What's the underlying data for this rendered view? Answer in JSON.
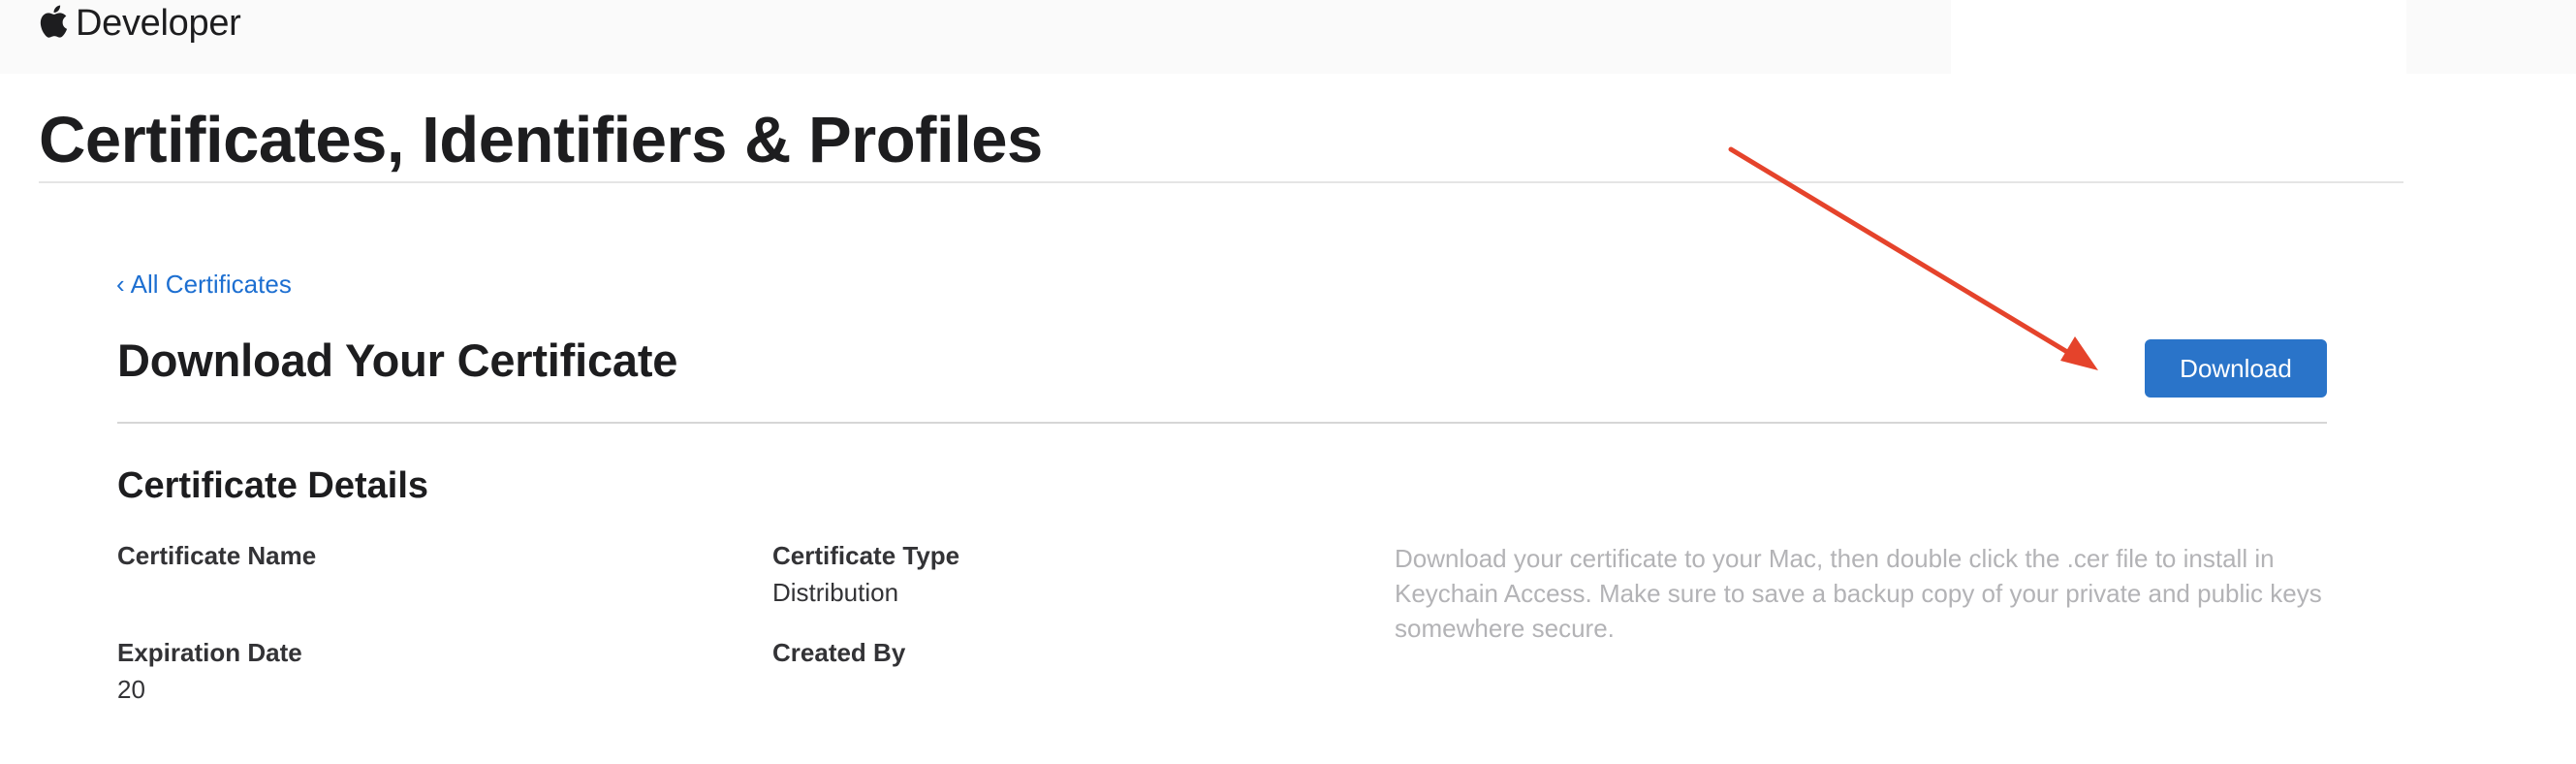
{
  "nav": {
    "brand_icon": "apple-logo-icon",
    "brand_label": "Developer"
  },
  "header": {
    "page_title": "Certificates, Identifiers & Profiles"
  },
  "main": {
    "back_link_chevron": "‹",
    "back_link_label": "All Certificates",
    "section_title": "Download Your Certificate",
    "download_button_label": "Download",
    "details": {
      "title": "Certificate Details",
      "certificate_name_label": "Certificate Name",
      "certificate_type_label": "Certificate Type",
      "certificate_type_value": "Distribution",
      "expiration_date_label": "Expiration Date",
      "expiration_date_value": "20",
      "created_by_label": "Created By",
      "help_text": "Download your certificate to your Mac, then double click the .cer file to install in Keychain Access. Make sure to save a backup copy of your private and public keys somewhere secure."
    }
  },
  "annotation": {
    "arrow_color": "#e5432b",
    "target": "download-button"
  },
  "colors": {
    "link": "#1d6fd1",
    "button": "#2a74c9",
    "help_text": "#b3b3b6"
  }
}
